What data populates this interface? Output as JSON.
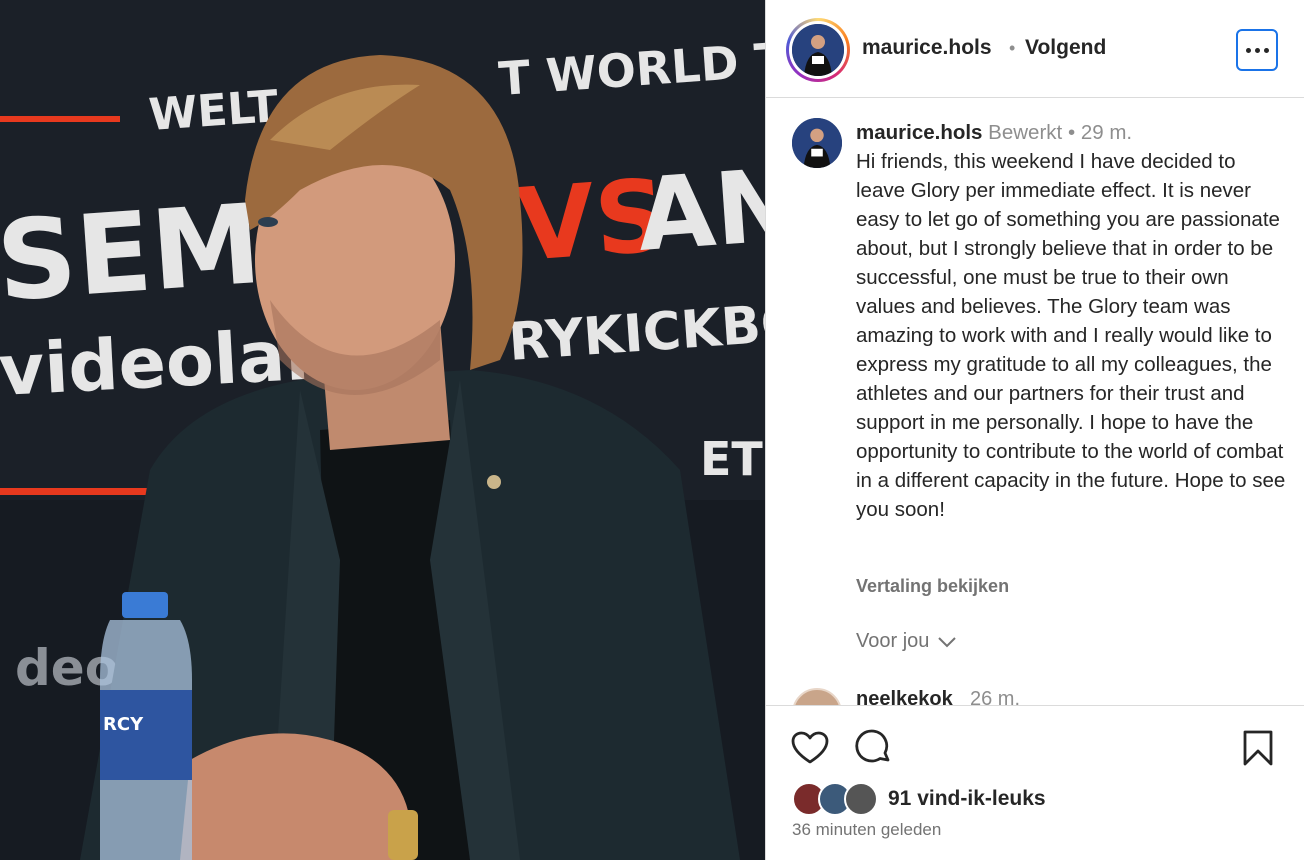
{
  "photo": {
    "description_icon": "post-photo",
    "backdrop_words": [
      "WELT",
      "T WORLD TIT",
      "SEMEL",
      "VS",
      "AN",
      "videolar",
      "RYKICKBO",
      "ET",
      "deo"
    ],
    "bottle_label": "RCY"
  },
  "header": {
    "username": "maurice.hols",
    "separator": "•",
    "follow_status": "Volgend",
    "more_icon": "more-options-icon"
  },
  "caption": {
    "username": "maurice.hols",
    "edited_label": "Bewerkt",
    "separator": "•",
    "time": "29 m.",
    "text": "Hi friends, this weekend I have decided to leave Glory per immediate effect. It is never easy to let go of something you are passionate about, but I strongly believe that in order to be successful, one must be true to their own values and believes. The Glory team was amazing to work with and I really would like to express my gratitude to all my colleagues, the athletes and our partners for their trust and support in me personally. I hope to have the opportunity to contribute to the world of combat in a different capacity in the future. Hope to see you soon!",
    "translate_label": "Vertaling bekijken"
  },
  "for_you": {
    "label": "Voor jou"
  },
  "next_comment": {
    "username": "neelkekok",
    "time": "26 m."
  },
  "actions": {
    "likes_label": "91 vind-ik-leuks",
    "time_ago": "36 minuten geleden"
  },
  "colors": {
    "accent": "#1a73e8",
    "text": "#262626",
    "muted": "#8e8e8e",
    "border": "#dbdbdb",
    "red_accent": "#e8391e"
  }
}
